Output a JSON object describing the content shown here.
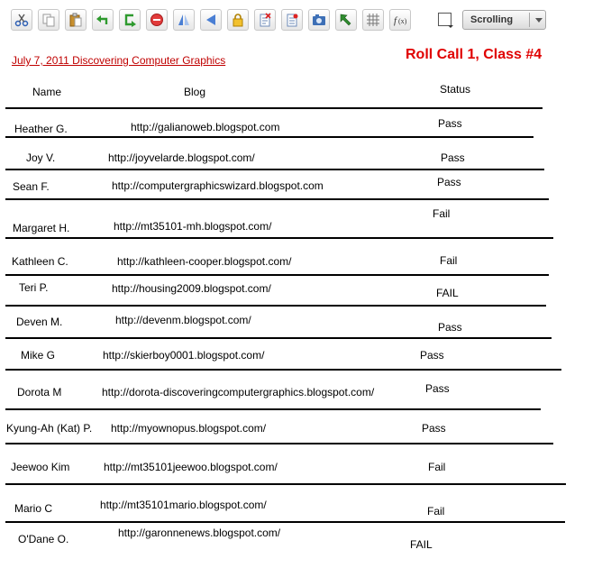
{
  "toolbar": {
    "buttons": [
      {
        "name": "cut-icon"
      },
      {
        "name": "copy-icon"
      },
      {
        "name": "paste-icon"
      },
      {
        "name": "undo-icon"
      },
      {
        "name": "redo-icon"
      },
      {
        "name": "delete-icon"
      },
      {
        "name": "flip-icon"
      },
      {
        "name": "back-icon"
      },
      {
        "name": "lock-icon"
      },
      {
        "name": "clear-icon"
      },
      {
        "name": "properties-icon"
      },
      {
        "name": "snapshot-icon"
      },
      {
        "name": "select-arrow-icon"
      },
      {
        "name": "grid-icon"
      },
      {
        "name": "function-icon"
      }
    ],
    "scroll_mode": "Scrolling"
  },
  "header": {
    "date_link": "July 7, 2011 Discovering Computer Graphics",
    "title": "Roll Call 1, Class #4"
  },
  "columns": {
    "name": "Name",
    "blog": "Blog",
    "status": "Status"
  },
  "rows": [
    {
      "name": "Heather G.",
      "blog": "http://galianoweb.blogspot.com",
      "status": "Pass"
    },
    {
      "name": "Joy V.",
      "blog": "http://joyvelarde.blogspot.com/",
      "status": "Pass"
    },
    {
      "name": "Sean F.",
      "blog": "http://computergraphicswizard.blogspot.com",
      "status": "Pass"
    },
    {
      "name": "Margaret H.",
      "blog": "http://mt35101-mh.blogspot.com/",
      "status": "Fail"
    },
    {
      "name": "Kathleen C.",
      "blog": "http://kathleen-cooper.blogspot.com/",
      "status": "Fail"
    },
    {
      "name": "Teri P.",
      "blog": "http://housing2009.blogspot.com/",
      "status": "FAIL"
    },
    {
      "name": "Deven M.",
      "blog": "http://devenm.blogspot.com/",
      "status": "Pass"
    },
    {
      "name": "Mike G",
      "blog": "http://skierboy0001.blogspot.com/",
      "status": "Pass"
    },
    {
      "name": "Dorota M",
      "blog": "http://dorota-discoveringcomputergraphics.blogspot.com/",
      "status": "Pass"
    },
    {
      "name": "Kyung-Ah (Kat) P.",
      "blog": "http://myownopus.blogspot.com/",
      "status": "Pass"
    },
    {
      "name": "Jeewoo Kim",
      "blog": "http://mt35101jeewoo.blogspot.com/",
      "status": "Fail"
    },
    {
      "name": "Mario C",
      "blog": "http://mt35101mario.blogspot.com/",
      "status": "Fail"
    },
    {
      "name": "O'Dane O.",
      "blog": "http://garonnenews.blogspot.com/",
      "status": "FAIL"
    }
  ]
}
